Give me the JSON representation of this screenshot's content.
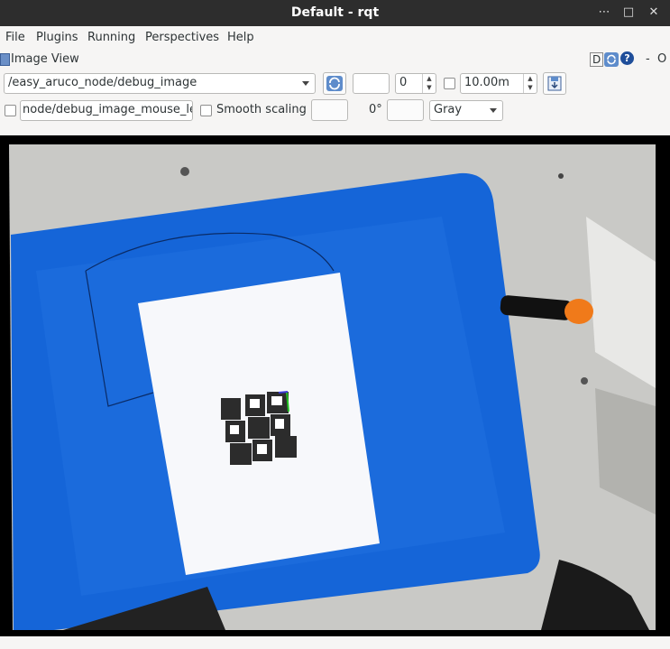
{
  "window": {
    "title": "Default - rqt",
    "minimize_glyph": "⋯",
    "maximize_glyph": "□",
    "close_glyph": "✕"
  },
  "menu": {
    "items": [
      "File",
      "Plugins",
      "Running",
      "Perspectives",
      "Help"
    ]
  },
  "plugin": {
    "title": "Image View",
    "d_label": "D",
    "help_glyph": "?",
    "dash_label": "-",
    "close_label": "O"
  },
  "toolbar": {
    "topic": "/easy_aruco_node/debug_image",
    "refresh_icon": "refresh-icon",
    "spin_value": "0",
    "max_range": "10.00m",
    "save_icon": "save-icon",
    "mouse_topic": "node/debug_image_mouse_left",
    "smooth_scaling_label": "Smooth scaling",
    "rotation": "0°",
    "color_scheme": "Gray"
  },
  "colors": {
    "titlebar": "#2d2d2d",
    "bin_blue": "#1565d8",
    "marker_dark": "#2c2c2c",
    "paper": "#f7f8fb"
  }
}
